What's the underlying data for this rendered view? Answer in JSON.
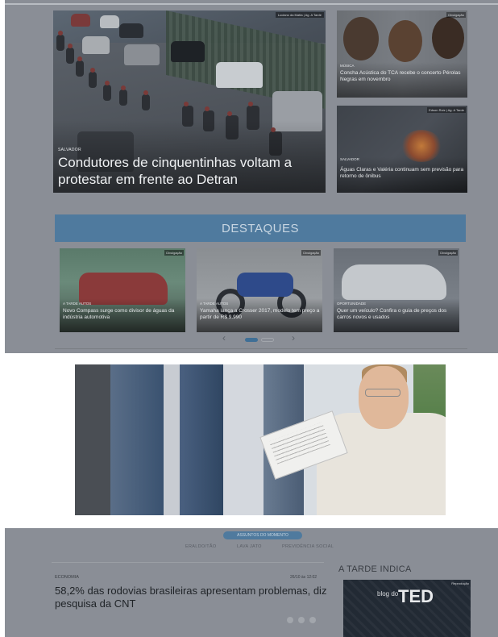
{
  "hero": {
    "credit": "Luciano da Matta | Ag. A Tarde",
    "kicker": "SALVADOR",
    "title": "Condutores de cinquentinhas voltam a protestar em frente ao Detran"
  },
  "side_cards": [
    {
      "credit": "Divulgação",
      "kicker": "MÚSICA",
      "title": "Concha Acústica do TCA recebe o concerto Pérolas Negras em novembro"
    },
    {
      "credit": "Edson Ruiz | Ag. A Tarde",
      "kicker": "SALVADOR",
      "title": "Águas Claras e Valéria continuam sem previsão para retorno de ônibus"
    }
  ],
  "destaques": {
    "label": "DESTAQUES"
  },
  "thumbs": [
    {
      "credit": "Divulgação",
      "kicker": "A TARDE AUTOS",
      "title": "Novo Compass surge como divisor de águas da indústria automotiva"
    },
    {
      "credit": "Divulgação",
      "kicker": "A TARDE AUTOS",
      "title": "Yamaha lança a Crosser 2017, modelo tem preço a partir de R$ 9.990"
    },
    {
      "credit": "Divulgação",
      "kicker": "OPORTUNIDADE",
      "title": "Quer um veículo? Confira o guia de preços dos carros novos e usados"
    }
  ],
  "carousel": {
    "prev_arrow": "‹",
    "next_arrow": "›"
  },
  "topics": {
    "badge": "ASSUNTOS DO MOMENTO",
    "items": [
      "ERALDO/TÃO",
      "LAVA JATO",
      "PREVIDÊNCIA SOCIAL"
    ]
  },
  "article": {
    "category": "ECONOMIA",
    "timestamp": "26/10 às 12:02",
    "headline": "58,2% das rodovias brasileiras apresentam problemas, diz pesquisa da CNT"
  },
  "indica": {
    "title": "A TARDE INDICA",
    "credit": "Reprodução",
    "blog_label": "blog do",
    "ted_label": "TED"
  },
  "colors": {
    "accent_blue": "#4f7a9e",
    "dim_overlay": "#8a8e96",
    "dot_active": "#3f6f96",
    "dot_inactive": "#a2a6ac"
  }
}
